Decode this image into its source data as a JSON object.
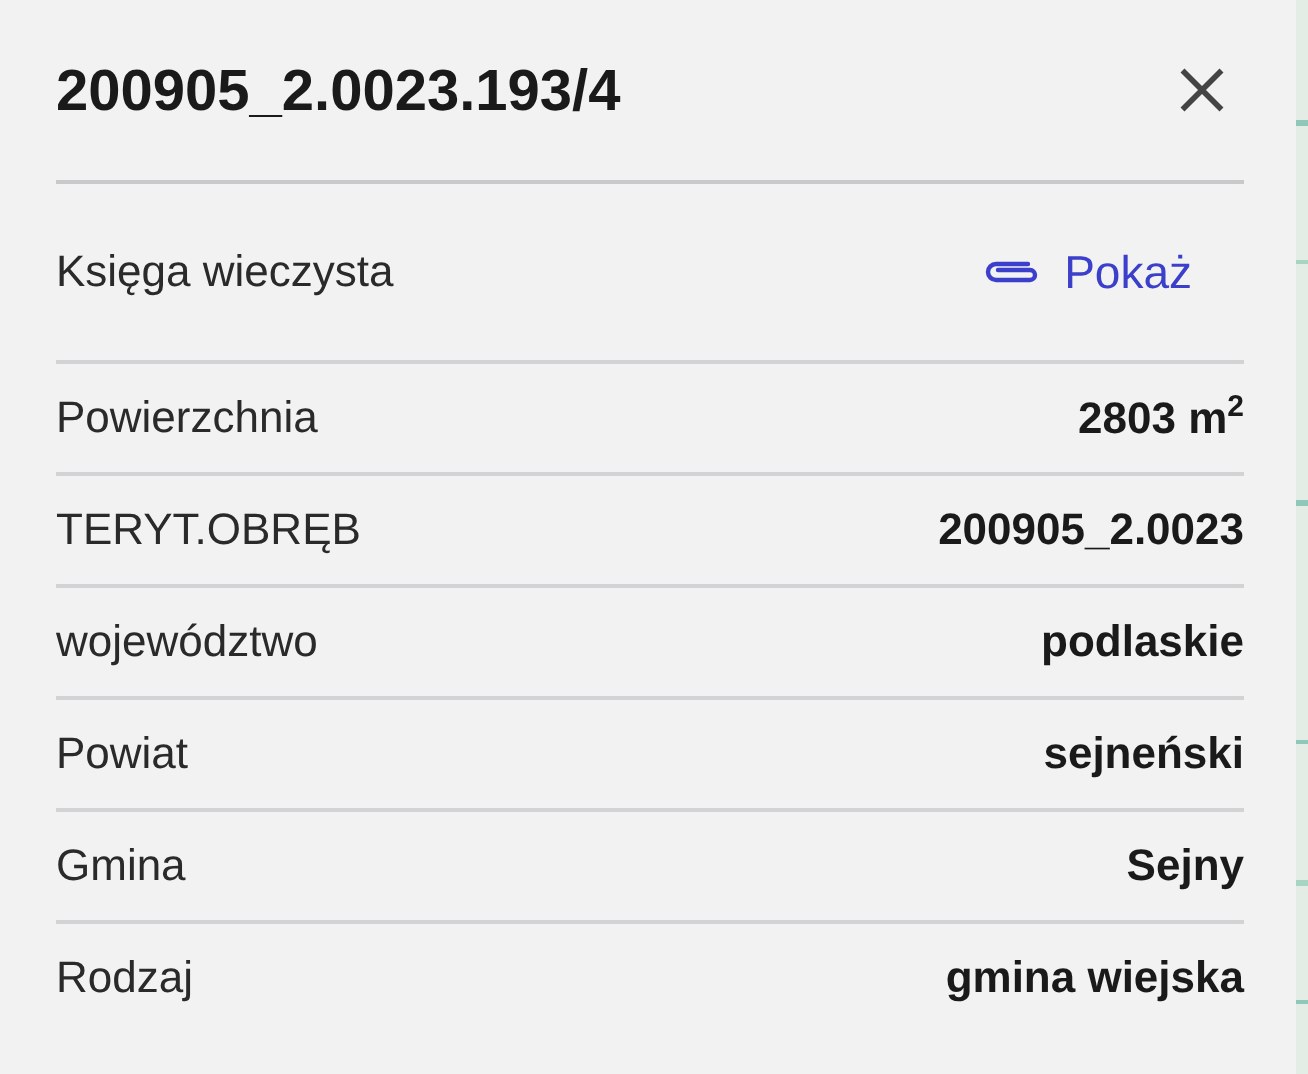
{
  "title": "200905_2.0023.193/4",
  "link_row": {
    "label": "Księga wieczysta",
    "link": "Pokaż"
  },
  "rows": [
    {
      "label": "Powierzchnia",
      "value": "2803 m$^{2}$"
    },
    {
      "label": "TERYT.OBRĘB",
      "value": "200905_2.0023"
    },
    {
      "label": "województwo",
      "value": "podlaskie"
    },
    {
      "label": "Powiat",
      "value": "sejneński"
    },
    {
      "label": "Gmina",
      "value": "Sejny"
    },
    {
      "label": "Rodzaj",
      "value": "gmina wiejska"
    }
  ]
}
